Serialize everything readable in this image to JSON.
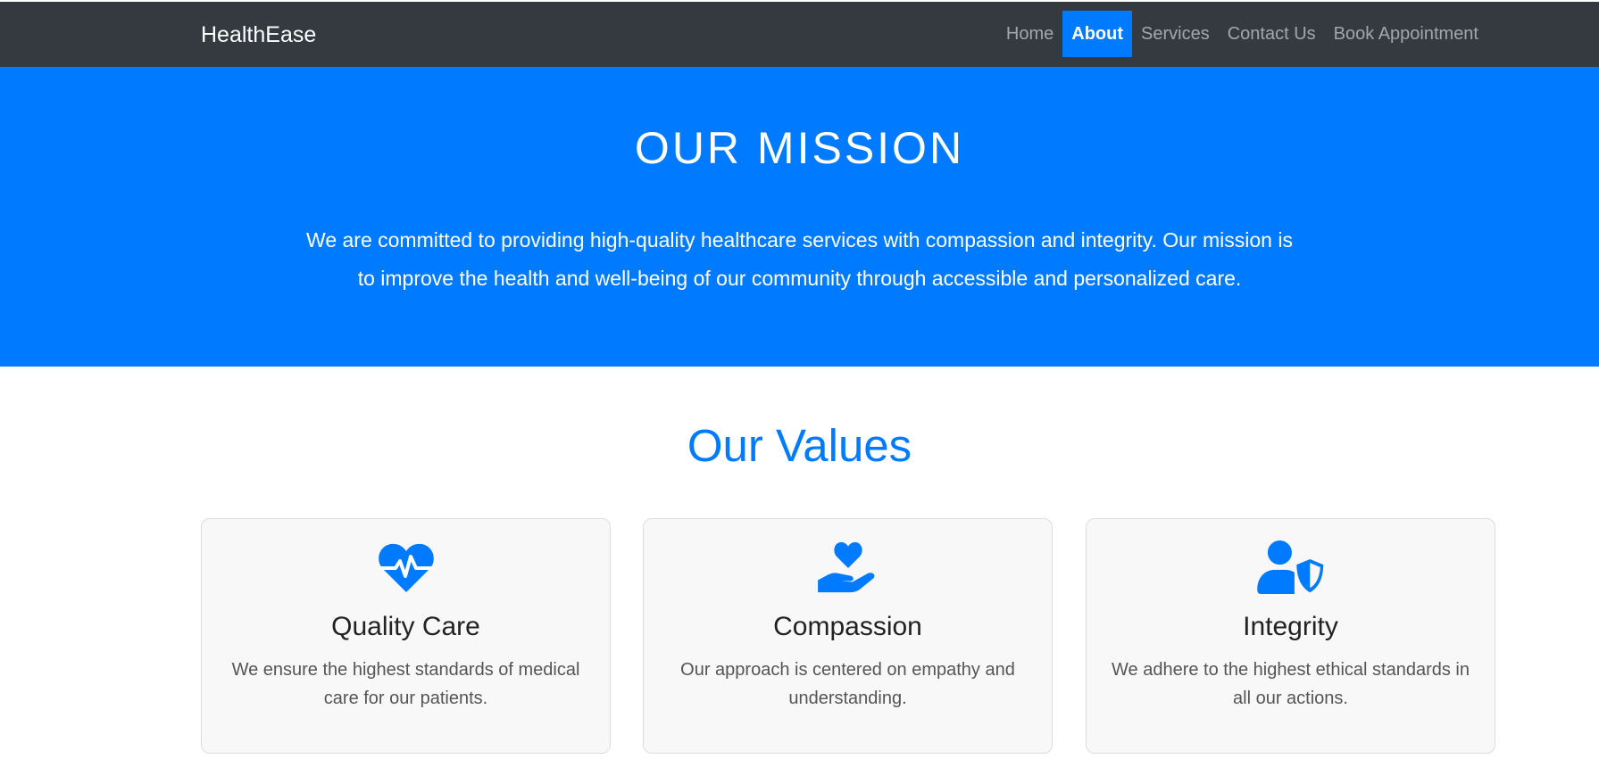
{
  "navbar": {
    "brand": "HealthEase",
    "links": [
      "Home",
      "About",
      "Services",
      "Contact Us",
      "Book Appointment"
    ],
    "active": "About"
  },
  "hero": {
    "title": "OUR MISSION",
    "text": "We are committed to providing high-quality healthcare services with compassion and integrity. Our mission is to improve the health and well-being of our community through accessible and personalized care."
  },
  "values": {
    "title": "Our Values",
    "cards": [
      {
        "icon": "heartbeat-icon",
        "title": "Quality Care",
        "text": "We ensure the highest standards of medical care for our patients."
      },
      {
        "icon": "hand-holding-heart-icon",
        "title": "Compassion",
        "text": "Our approach is centered on empathy and understanding."
      },
      {
        "icon": "user-shield-icon",
        "title": "Integrity",
        "text": "We adhere to the highest ethical standards in all our actions."
      }
    ]
  },
  "colors": {
    "primary": "#007bff",
    "navbar": "#343a40",
    "card_bg": "#f8f8f8"
  }
}
